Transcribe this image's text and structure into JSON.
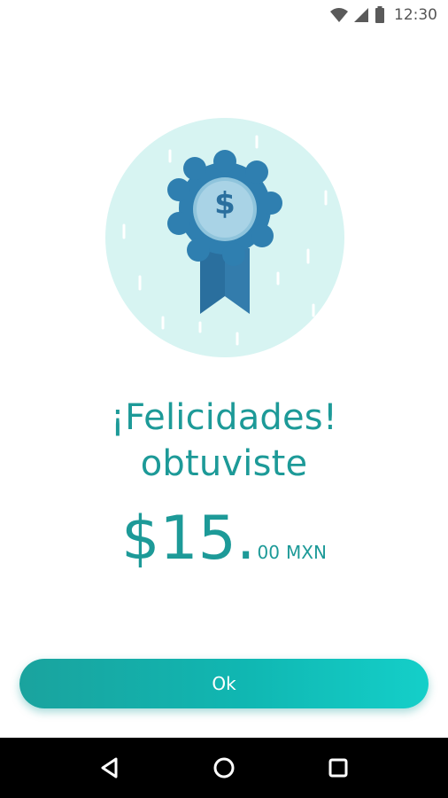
{
  "status_bar": {
    "time": "12:30",
    "icons": [
      "wifi-icon",
      "cell-signal-icon",
      "battery-icon"
    ]
  },
  "illustration": {
    "icon": "award-ribbon-dollar-icon",
    "symbol": "$"
  },
  "message": {
    "line1": "¡Felicidades!",
    "line2": "obtuviste"
  },
  "reward": {
    "amount_main": "$15.",
    "amount_cents": "00",
    "currency": "MXN"
  },
  "ok_button": {
    "label": "Ok"
  },
  "nav_bar": {
    "icons": [
      "back-icon",
      "home-icon",
      "recents-icon"
    ]
  },
  "colors": {
    "accent": "#1d9a98",
    "button_start": "#1aa39e",
    "button_end": "#14cfc9",
    "circle_bg": "#d7f4f2",
    "ribbon": "#2f7fb0"
  }
}
